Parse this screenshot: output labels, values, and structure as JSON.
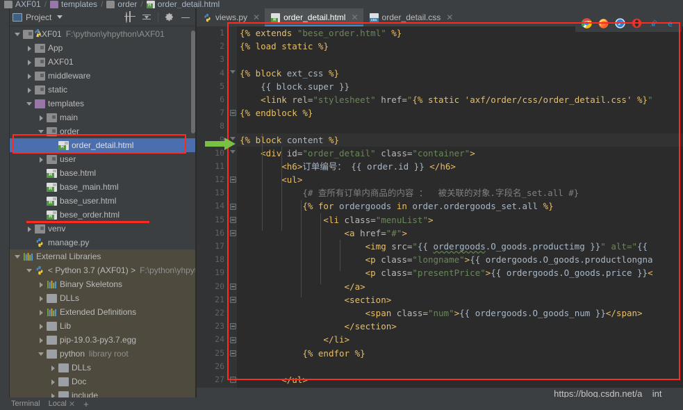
{
  "breadcrumb": [
    {
      "label": "AXF01",
      "icon": "folder-icon"
    },
    {
      "label": "templates",
      "icon": "folder-purple-icon"
    },
    {
      "label": "order",
      "icon": "folder-icon"
    },
    {
      "label": "order_detail.html",
      "icon": "html-file-icon"
    }
  ],
  "project_panel": {
    "title": "Project",
    "tools": [
      {
        "name": "locate-icon",
        "label": ""
      },
      {
        "name": "collapse-all-icon",
        "label": ""
      },
      {
        "name": "gear-icon",
        "label": ""
      },
      {
        "name": "minimize-icon",
        "label": ""
      }
    ],
    "tree": [
      {
        "label": "AXF01",
        "suffix": "F:\\python\\yhpython\\AXF01",
        "twist": "down",
        "icon": "folder",
        "indent": 0,
        "state": "normal"
      },
      {
        "label": "App",
        "suffix": "",
        "twist": "right",
        "icon": "folder",
        "indent": 1,
        "state": "normal"
      },
      {
        "label": "AXF01",
        "suffix": "",
        "twist": "right",
        "icon": "folder",
        "indent": 1,
        "state": "normal"
      },
      {
        "label": "middleware",
        "suffix": "",
        "twist": "right",
        "icon": "folder",
        "indent": 1,
        "state": "normal"
      },
      {
        "label": "static",
        "suffix": "",
        "twist": "right",
        "icon": "folder",
        "indent": 1,
        "state": "normal"
      },
      {
        "label": "templates",
        "suffix": "",
        "twist": "down",
        "icon": "folder-purple",
        "indent": 1,
        "state": "normal"
      },
      {
        "label": "main",
        "suffix": "",
        "twist": "right",
        "icon": "folder",
        "indent": 2,
        "state": "normal"
      },
      {
        "label": "order",
        "suffix": "",
        "twist": "down",
        "icon": "folder",
        "indent": 2,
        "state": "normal"
      },
      {
        "label": "order_detail.html",
        "suffix": "",
        "twist": "none",
        "icon": "html",
        "indent": 3,
        "state": "selected"
      },
      {
        "label": "user",
        "suffix": "",
        "twist": "right",
        "icon": "folder",
        "indent": 2,
        "state": "normal"
      },
      {
        "label": "base.html",
        "suffix": "",
        "twist": "none",
        "icon": "html",
        "indent": 2,
        "state": "normal"
      },
      {
        "label": "base_main.html",
        "suffix": "",
        "twist": "none",
        "icon": "html",
        "indent": 2,
        "state": "normal"
      },
      {
        "label": "base_user.html",
        "suffix": "",
        "twist": "none",
        "icon": "html",
        "indent": 2,
        "state": "normal"
      },
      {
        "label": "bese_order.html",
        "suffix": "",
        "twist": "none",
        "icon": "html",
        "indent": 2,
        "state": "normal"
      },
      {
        "label": "venv",
        "suffix": "",
        "twist": "right",
        "icon": "folder",
        "indent": 1,
        "state": "normal"
      },
      {
        "label": "manage.py",
        "suffix": "",
        "twist": "none",
        "icon": "py",
        "indent": 1,
        "state": "normal"
      },
      {
        "label": "External Libraries",
        "suffix": "",
        "twist": "down",
        "icon": "lib",
        "indent": 0,
        "state": "libs"
      },
      {
        "label": "< Python 3.7 (AXF01) >",
        "suffix": "F:\\python\\yhpyt",
        "twist": "down",
        "icon": "py",
        "indent": 1,
        "state": "libs"
      },
      {
        "label": "Binary Skeletons",
        "suffix": "",
        "twist": "right",
        "icon": "lib",
        "indent": 2,
        "state": "libs"
      },
      {
        "label": "DLLs",
        "suffix": "",
        "twist": "right",
        "icon": "folder-plain",
        "indent": 2,
        "state": "libs"
      },
      {
        "label": "Extended Definitions",
        "suffix": "",
        "twist": "right",
        "icon": "lib",
        "indent": 2,
        "state": "libs"
      },
      {
        "label": "Lib",
        "suffix": "",
        "twist": "right",
        "icon": "folder-plain",
        "indent": 2,
        "state": "libs"
      },
      {
        "label": "pip-19.0.3-py3.7.egg",
        "suffix": "",
        "twist": "right",
        "icon": "folder-plain",
        "indent": 2,
        "state": "libs"
      },
      {
        "label": "python",
        "suffix": "library root",
        "twist": "down",
        "icon": "folder-plain",
        "indent": 2,
        "state": "libs"
      },
      {
        "label": "DLLs",
        "suffix": "",
        "twist": "right",
        "icon": "folder-plain",
        "indent": 3,
        "state": "libs"
      },
      {
        "label": "Doc",
        "suffix": "",
        "twist": "right",
        "icon": "folder-plain",
        "indent": 3,
        "state": "libs"
      },
      {
        "label": "include",
        "suffix": "",
        "twist": "right",
        "icon": "folder-plain",
        "indent": 3,
        "state": "libs"
      }
    ]
  },
  "tabs": [
    {
      "label": "views.py",
      "icon": "python-file-icon",
      "active": false
    },
    {
      "label": "order_detail.html",
      "icon": "html-file-icon",
      "active": true
    },
    {
      "label": "order_detail.css",
      "icon": "css-file-icon",
      "active": false
    }
  ],
  "browser_icons": [
    {
      "name": "chrome-icon",
      "color": "#4caf50"
    },
    {
      "name": "firefox-icon",
      "color": "#e8732c"
    },
    {
      "name": "safari-icon",
      "color": "#3a8ee6"
    },
    {
      "name": "opera-icon",
      "color": "#e02020"
    },
    {
      "name": "internet-explorer-icon",
      "color": "#2d8fd5"
    },
    {
      "name": "edge-icon",
      "color": "#1ba1e2"
    }
  ],
  "editor": {
    "current_line": 9,
    "line_numbers": [
      1,
      2,
      3,
      4,
      5,
      6,
      7,
      8,
      9,
      10,
      11,
      12,
      13,
      14,
      15,
      16,
      17,
      18,
      19,
      20,
      21,
      22,
      23,
      24,
      25,
      26,
      27
    ],
    "lines": [
      "{% extends \"bese_order.html\" %}",
      "{% load static %}",
      "",
      "{% block ext_css %}",
      "    {{ block.super }}",
      "    <link rel=\"stylesheet\" href=\"{% static 'axf/order/css/order_detail.css' %}\"",
      "{% endblock %}",
      "",
      "{% block content %}",
      "    <div id=\"order_detail\" class=\"container\">",
      "        <h6>订单编号： {{ order.id }} </h6>",
      "        <ul>",
      "            {# 查所有订单内商品的内容 ：  被关联的对象.字段名_set.all #}",
      "            {% for ordergoods in order.ordergoods_set.all %}",
      "                <li class=\"menuList\">",
      "                    <a href=\"#\">",
      "                        <img src=\"{{ ordergoods.O_goods.productimg }}\" alt=\"{{",
      "                        <p class=\"longname\">{{ ordergoods.O_goods.productlongna",
      "                        <p class=\"presentPrice\">{{ ordergoods.O_goods.price }}<",
      "                    </a>",
      "                    <section>",
      "                        <span class=\"num\">{{ ordergoods.O_goods_num }}</span>",
      "                    </section>",
      "                </li>",
      "            {% endfor %}",
      "",
      "        </ul>"
    ]
  },
  "bottom_bar": {
    "items": [
      "Terminal",
      "Local"
    ],
    "add_label": "+"
  },
  "watermark": "https://blog.csdn.net/a__int__",
  "annotations": {
    "editor_box_color": "#ff2a20",
    "tree_box_color": "#ff2a20",
    "arrow_color": "#7ac143"
  }
}
